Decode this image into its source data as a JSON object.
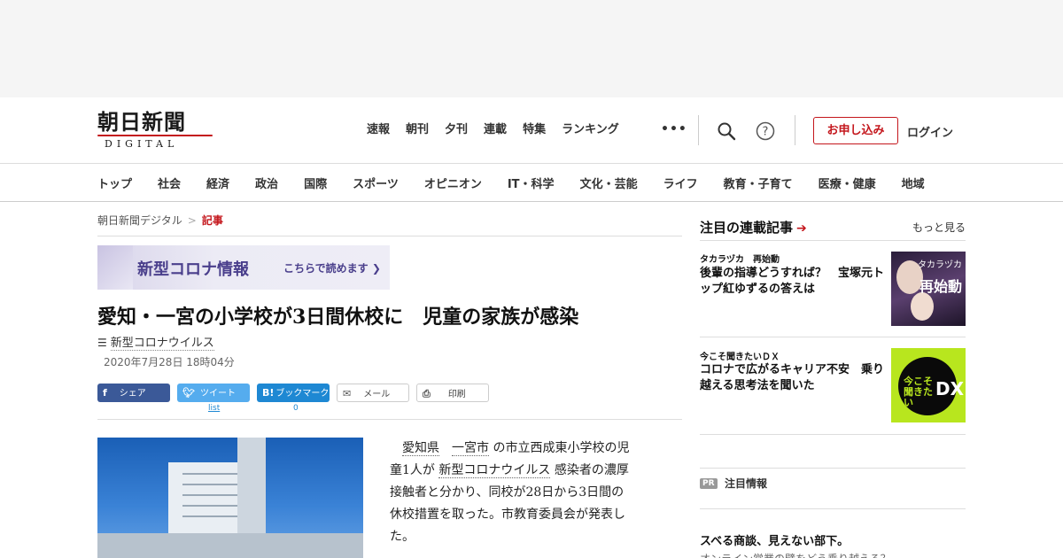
{
  "header": {
    "logo_main": "朝日新聞",
    "logo_sub": "DIGITAL",
    "topnav": [
      "速報",
      "朝刊",
      "夕刊",
      "連載",
      "特集",
      "ランキング"
    ],
    "more": "•••",
    "apply": "お申し込み",
    "login": "ログイン"
  },
  "categories": [
    "トップ",
    "社会",
    "経済",
    "政治",
    "国際",
    "スポーツ",
    "オピニオン",
    "IT・科学",
    "文化・芸能",
    "ライフ",
    "教育・子育て",
    "医療・健康",
    "地域"
  ],
  "breadcrumb": {
    "home": "朝日新聞デジタル",
    "sep": ">",
    "current": "記事"
  },
  "corona_banner": {
    "title": "新型コロナ情報",
    "link": "こちらで読めます ❯"
  },
  "article": {
    "headline": "愛知・一宮の小学校が3日間休校に　児童の家族が感染",
    "topic": "新型コロナウイルス",
    "date": "2020年7月28日 18時04分",
    "body_line1_a": "愛知県",
    "body_line1_b": "一宮市",
    "body_line1_c": "の市立西成東小学校の児",
    "body_line2_a": "童1人が",
    "body_line2_b": "新型コロナウイルス",
    "body_line2_c": "感染者の濃厚",
    "body_line3": "接触者と分かり、同校が28日から3日間の",
    "body_line4": "休校措置を取った。市教育委員会が発表し",
    "body_line5": "た。"
  },
  "share": {
    "facebook": "シェア",
    "twitter": "ツイート",
    "hatena": "ブックマーク",
    "mail": "メール",
    "print": "印刷",
    "twitter_count": "list",
    "hatena_count": "0"
  },
  "sidebar": {
    "title": "注目の連載記事",
    "more": "もっと見る",
    "cards": [
      {
        "label": "タカラヅカ　再始動",
        "text": "後輩の指導どうすれば？　宝塚元トップ紅ゆずるの答えは",
        "thumb_text1": "タカラヅカ",
        "thumb_text2": "再始動"
      },
      {
        "label": "今こそ聞きたいＤＸ",
        "text": "コロナで広がるキャリア不安　乗り越える思考法を聞いた",
        "thumb_text1": "今こそ聞きたい",
        "thumb_text2": "DX"
      }
    ],
    "pr_badge": "PR",
    "pr_title": "注目情報",
    "pr_head": "スベる商談、見えない部下。",
    "pr_sub": "オンライン営業の壁をどう乗り越える？"
  },
  "colors": {
    "accent": "#c4161c",
    "facebook": "#3b5998",
    "twitter": "#55acee",
    "hatena": "#1e88d3"
  }
}
